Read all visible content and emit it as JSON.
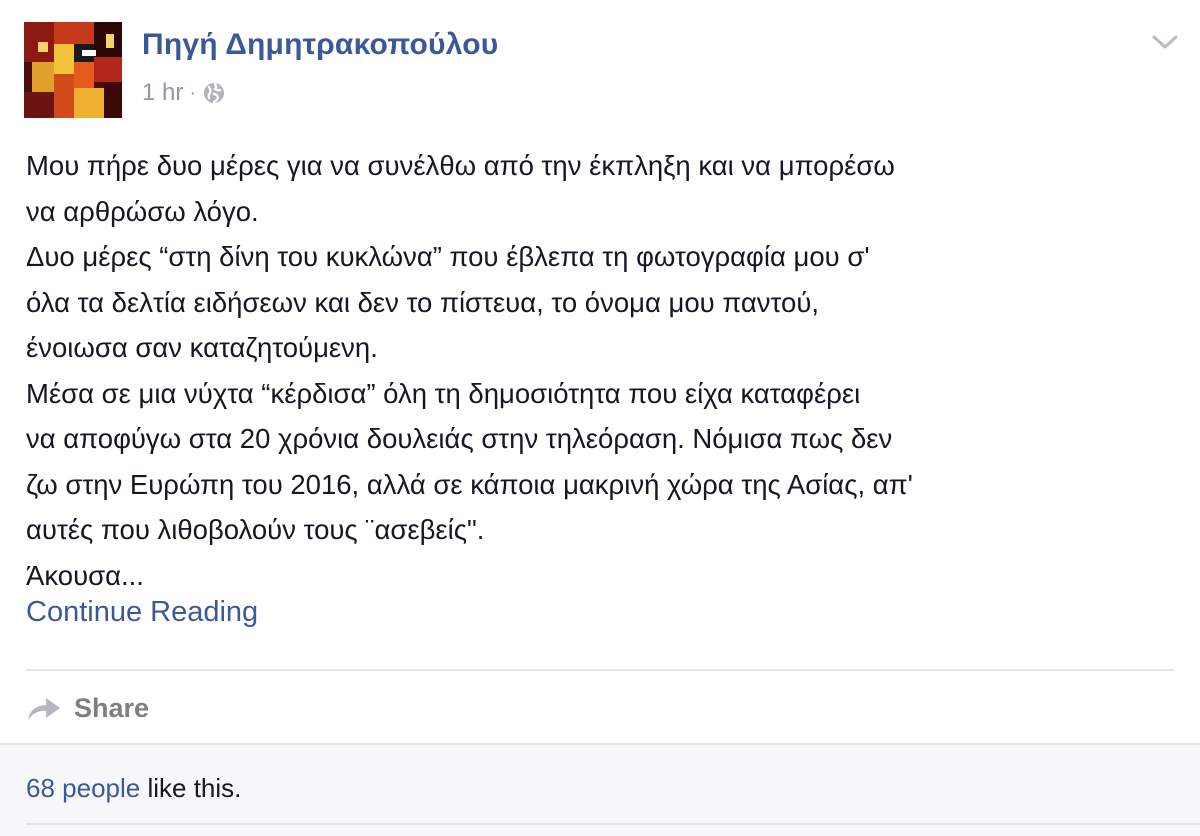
{
  "post": {
    "author": "Πηγή Δημητρακοπούλου",
    "timestamp": "1 hr",
    "separator": "·",
    "privacy_icon": "globe-icon",
    "menu_icon": "chevron-down-icon",
    "avatar": "profile-avatar"
  },
  "body": {
    "lines": [
      "Μου πήρε δυο μέρες για να συνέλθω από την έκπληξη και να μπορέσω",
      "να αρθρώσω λόγο.",
      "Δυο μέρες “στη δίνη του κυκλώνα” που έβλεπα τη φωτογραφία μου σ'",
      "όλα τα δελτία ειδήσεων και δεν το πίστευα, το όνομα μου παντού,",
      "ένοιωσα σαν καταζητούμενη.",
      "Μέσα σε μια νύχτα “κέρδισα” όλη τη δημοσιότητα που είχα καταφέρει",
      "να αποφύγω στα 20 χρόνια δουλειάς στην τηλεόραση. Νόμισα πως δεν",
      "ζω στην Ευρώπη του 2016, αλλά σε κάποια μακρινή χώρα της Ασίας, απ'",
      "αυτές που λιθοβολούν τους ¨ασεβείς\".",
      "Άκουσα..."
    ],
    "continue_label": "Continue Reading"
  },
  "actions": {
    "share_label": "Share",
    "share_icon": "share-arrow-icon"
  },
  "likes": {
    "people": "68 people",
    "suffix": " like this."
  },
  "colors": {
    "link": "#3b5998",
    "text": "#141823",
    "meta": "#9197a3",
    "likes_bg": "#f6f7f9"
  }
}
